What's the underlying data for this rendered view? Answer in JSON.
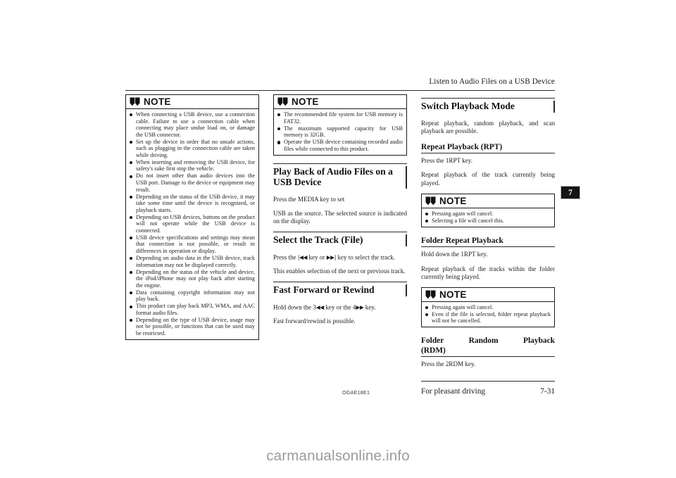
{
  "header": {
    "running_title": "Listen to Audio Files on a USB Device"
  },
  "note_label": "NOTE",
  "column1": {
    "note1_items": [
      "When connecting a USB device, use a connection cable. Failure to use a connection cable when connecting may place undue load on, or damage the USB connector.",
      "Set up the device in order that no unsafe actions, such as plugging in the connection cable are taken while driving.",
      "When inserting and removing the USB device, for safety's sake first stop the vehicle.",
      "Do not insert other than audio devices into the USB port. Damage to the device or equipment may result.",
      "Depending on the status of the USB device, it may take some time until the device is recognized, or playback starts.",
      "Depending on USB devices, buttons on the product will not operate while the USB device is connected.",
      "USB device specifications and settings may mean that connection is not possible, or result in differences in operation or display.",
      "Depending on audio data in the USB device, track information may not be displayed correctly.",
      "Depending on the status of the vehicle and device, the iPod/iPhone may not play back after starting the engine.",
      "Data containing copyright information may not play back.",
      "This product can play back MP3, WMA, and AAC format audio files.",
      "Depending on the type of USB device, usage may not be possible, or functions that can be used may be restricted."
    ]
  },
  "column2": {
    "note1_items": [
      "The recommended file system for USB memory is FAT32.",
      "The maximum supported capacity for USB memory is 32GB.",
      "Operate the USB device containing recorded audio files while connected to this product."
    ],
    "heading_playback": "Play Back of Audio Files on a USB Device",
    "para_press_media": "Press the MEDIA key to set",
    "para_usb_source": "USB as the source. The selected source is indicated on the display.",
    "heading_select_track": "Select the Track (File)",
    "para_select_track_pre": "Press the ",
    "key_prev": "|◀◀",
    "para_select_track_mid": " key or ",
    "key_next": "▶▶|",
    "para_select_track_post": " key to select the track.",
    "para_select_track2": "This enables selection of the next or previous track.",
    "heading_fast_forward": "Fast Forward or Rewind",
    "para_ff_pre": "Hold down the 3",
    "key_rew": "◀◀",
    "para_ff_mid": " key or the 4",
    "key_ff": "▶▶",
    "para_ff_post": " key.",
    "para_ff2": "Fast forward/rewind is possible."
  },
  "column3": {
    "heading_switch_mode": "Switch Playback Mode",
    "para_switch_mode": "Repeat playback, random playback, and scan playback are possible.",
    "heading_rpt": "Repeat Playback (RPT)",
    "para_rpt_press": "Press the 1RPT key.",
    "para_rpt_desc": "Repeat playback of the track currently being played.",
    "note1_items": [
      "Pressing again will cancel.",
      "Selecting a file will cancel this."
    ],
    "heading_folder_rpt": "Folder Repeat Playback",
    "para_folder_rpt_press": "Hold down the 1RPT key.",
    "para_folder_rpt_desc": "Repeat playback of the tracks within the folder currently being played.",
    "note2_items": [
      "Pressing again will cancel.",
      "Even if the file is selected, folder repeat playback will not be cancelled."
    ],
    "heading_folder_rdm_line1": "Folder Random Playback",
    "heading_folder_rdm_line2": "(RDM)",
    "para_rdm_press": "Press the 2RDM key."
  },
  "page_tab": {
    "number": "7"
  },
  "footer": {
    "code": "OGAE18E1",
    "text": "For pleasant driving",
    "page_number": "7-31"
  },
  "watermark": "carmanualsonline.info",
  "colors": {
    "ink": "#1a1a1a",
    "rule": "#2a2a2a",
    "tab_bg": "#151515",
    "watermark": "#9b9b9b"
  }
}
